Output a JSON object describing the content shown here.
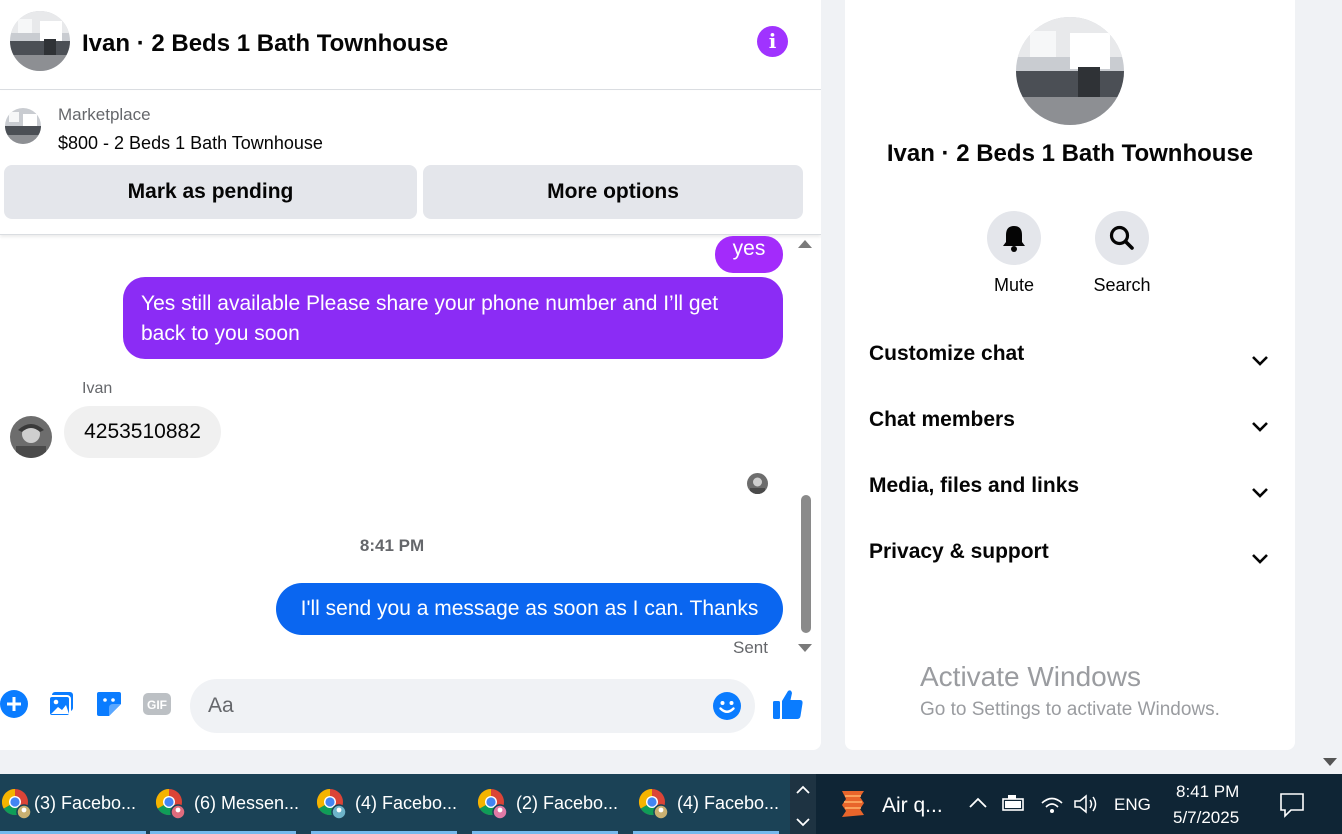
{
  "header": {
    "title": "Ivan · 2 Beds 1 Bath Townhouse",
    "info_icon": "info-icon",
    "accent_color": "#a033ff"
  },
  "marketplace": {
    "label": "Marketplace",
    "item": "$800 - 2 Beds 1 Bath Townhouse",
    "mark_pending": "Mark as pending",
    "more_options": "More options"
  },
  "messages": {
    "yes": "yes",
    "long": "Yes still available Please share your phone number and I’ll get back to you soon",
    "sender": "Ivan",
    "phone": "4253510882",
    "timestamp": "8:41 PM",
    "sent_message": "I'll send you a message as soon as I can. Thanks",
    "status": "Sent"
  },
  "composer": {
    "placeholder": "Aa",
    "icons": [
      "plus-icon",
      "image-icon",
      "sticker-icon",
      "gif-icon",
      "emoji-icon",
      "thumbs-up-icon"
    ]
  },
  "details": {
    "title": "Ivan · 2 Beds 1 Bath Townhouse",
    "actions": [
      {
        "label": "Mute",
        "icon": "bell-icon"
      },
      {
        "label": "Search",
        "icon": "search-icon"
      }
    ],
    "sections": [
      {
        "label": "Customize chat"
      },
      {
        "label": "Chat members"
      },
      {
        "label": "Media, files and links"
      },
      {
        "label": "Privacy & support"
      }
    ]
  },
  "watermark": {
    "line1": "Activate Windows",
    "line2": "Go to Settings to activate Windows."
  },
  "taskbar": {
    "items": [
      {
        "label": "(3) Facebo..."
      },
      {
        "label": "(6) Messen..."
      },
      {
        "label": "(4) Facebo..."
      },
      {
        "label": "(2) Facebo..."
      },
      {
        "label": "(4) Facebo..."
      }
    ],
    "weather": "Air q...",
    "language": "ENG",
    "time": "8:41 PM",
    "date": "5/7/2025"
  }
}
